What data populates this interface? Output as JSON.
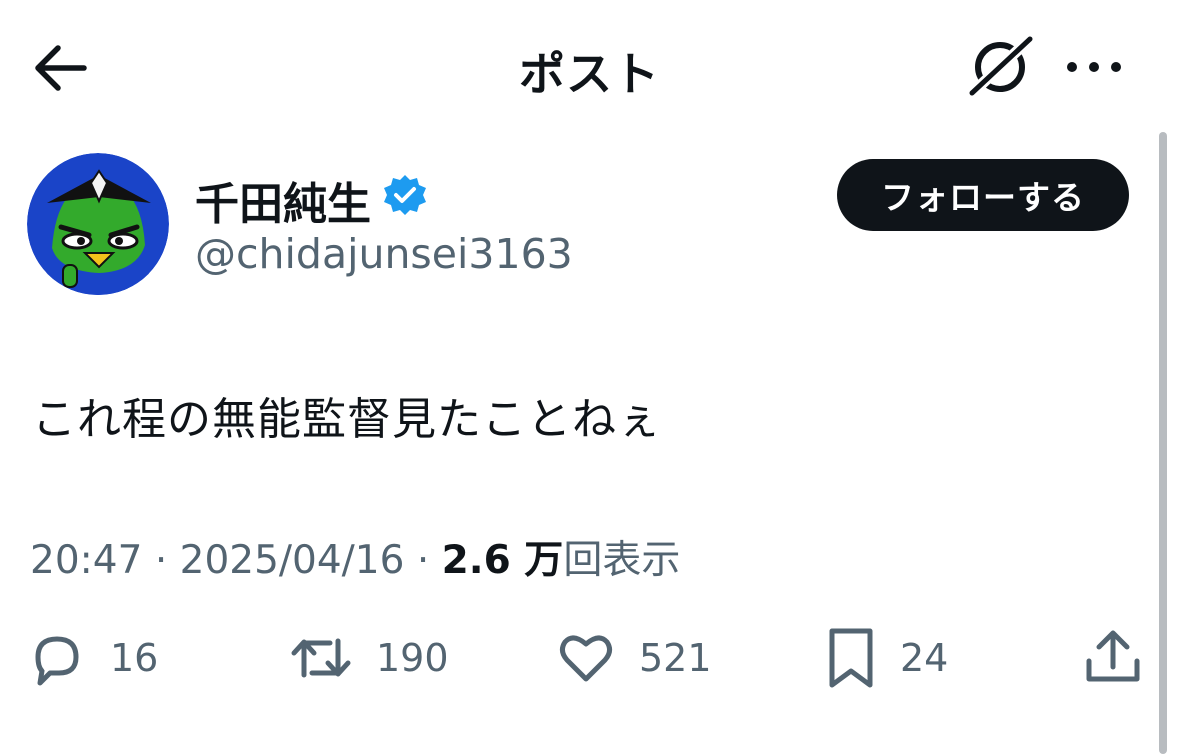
{
  "header": {
    "title": "ポスト",
    "back_icon": "arrow-left-icon",
    "grok_icon": "grok-icon",
    "more_icon": "more-horizontal-icon"
  },
  "author": {
    "display_name": "千田純生",
    "handle": "@chidajunsei3163",
    "verified": true,
    "verified_color": "#1d9bf0",
    "follow_label": "フォローする"
  },
  "post": {
    "text": "これ程の無能監督見たことねぇ",
    "time": "20:47",
    "date": "2025/04/16",
    "separator": "·",
    "views_count": "2.6 万",
    "views_label": "回表示"
  },
  "actions": {
    "replies": "16",
    "reposts": "190",
    "likes": "521",
    "bookmarks": "24"
  },
  "colors": {
    "text_primary": "#0f1419",
    "text_secondary": "#536471",
    "button_bg": "#0f1419",
    "accent": "#1d9bf0"
  }
}
